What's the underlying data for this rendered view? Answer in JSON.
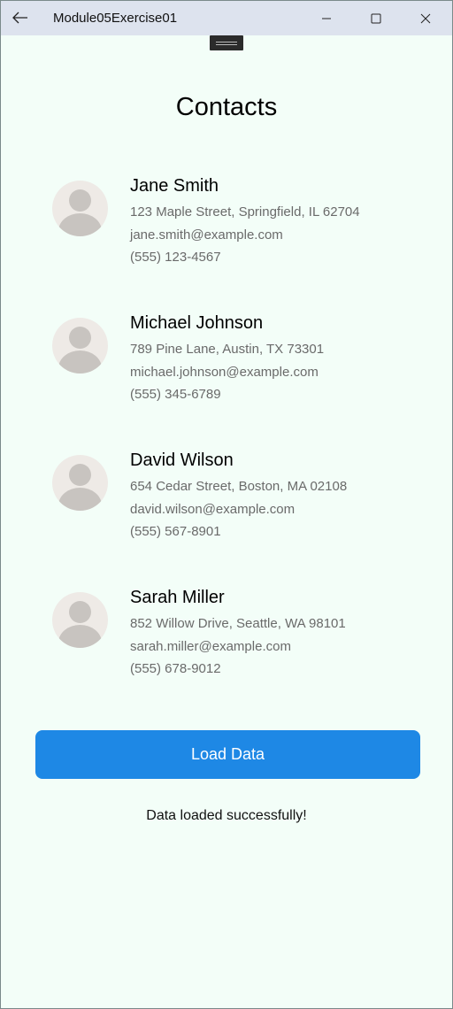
{
  "window": {
    "title": "Module05Exercise01"
  },
  "page": {
    "title": "Contacts"
  },
  "contacts": [
    {
      "name": "Jane Smith",
      "address": "123 Maple Street, Springfield, IL 62704",
      "email": "jane.smith@example.com",
      "phone": "(555) 123-4567"
    },
    {
      "name": "Michael Johnson",
      "address": "789 Pine Lane, Austin, TX 73301",
      "email": "michael.johnson@example.com",
      "phone": "(555) 345-6789"
    },
    {
      "name": "David Wilson",
      "address": "654 Cedar Street, Boston, MA 02108",
      "email": "david.wilson@example.com",
      "phone": "(555) 567-8901"
    },
    {
      "name": "Sarah Miller",
      "address": "852 Willow Drive, Seattle, WA 98101",
      "email": "sarah.miller@example.com",
      "phone": "(555) 678-9012"
    }
  ],
  "actions": {
    "load_label": "Load Data"
  },
  "status": {
    "message": "Data loaded successfully!"
  },
  "colors": {
    "accent": "#1e88e5",
    "background": "#f3fef8",
    "titlebar": "#dde3ee",
    "avatar_bg": "#eeeae6",
    "avatar_fg": "#c8c4c0"
  },
  "icons": {
    "back": "arrow-left-icon",
    "minimize": "minimize-icon",
    "maximize": "maximize-icon",
    "close": "close-icon",
    "avatar": "person-icon"
  }
}
